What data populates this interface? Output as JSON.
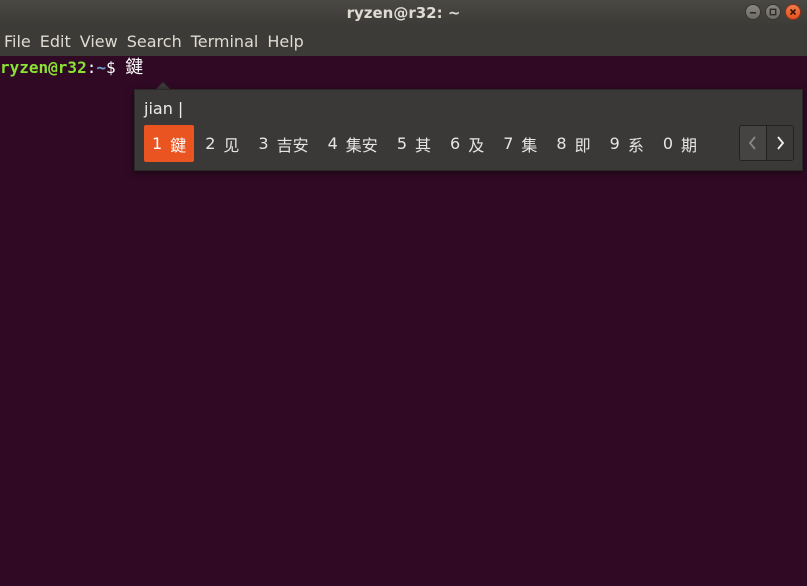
{
  "window": {
    "title": "ryzen@r32: ~"
  },
  "menu": [
    "File",
    "Edit",
    "View",
    "Search",
    "Terminal",
    "Help"
  ],
  "terminal": {
    "user_host": "ryzen@r32",
    "sep": ":",
    "path": "~",
    "prompt_char": "$ ",
    "input": "鍵"
  },
  "ime": {
    "preedit": "jian |",
    "candidates": [
      {
        "num": "1",
        "text": "鍵",
        "selected": true
      },
      {
        "num": "2",
        "text": "见"
      },
      {
        "num": "3",
        "text": "吉安"
      },
      {
        "num": "4",
        "text": "集安"
      },
      {
        "num": "5",
        "text": "其"
      },
      {
        "num": "6",
        "text": "及"
      },
      {
        "num": "7",
        "text": "集"
      },
      {
        "num": "8",
        "text": "即"
      },
      {
        "num": "9",
        "text": "系"
      },
      {
        "num": "0",
        "text": "期"
      }
    ],
    "prev_icon": "chevron-left-icon",
    "next_icon": "chevron-right-icon",
    "accent": "#e95420"
  },
  "colors": {
    "terminal_bg": "#300a24",
    "prompt_user": "#8ae234",
    "prompt_path": "#729fcf"
  }
}
